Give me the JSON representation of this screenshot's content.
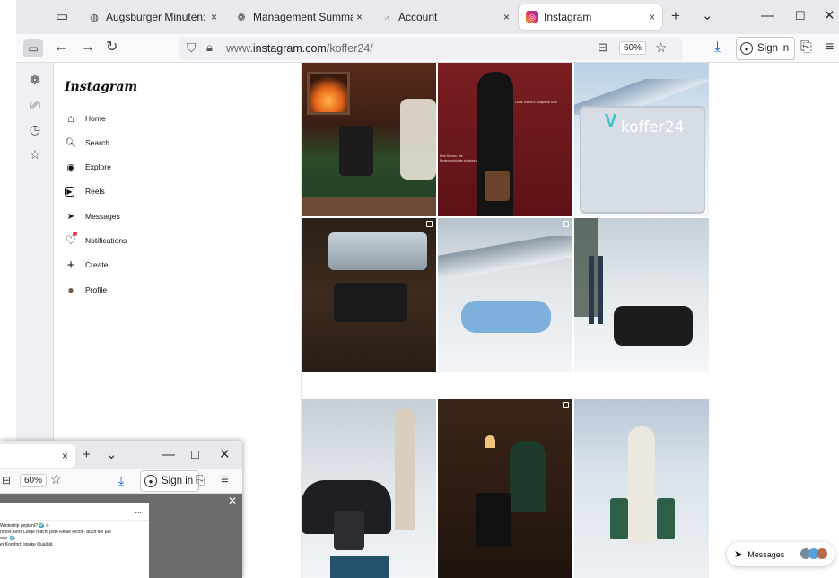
{
  "browser": {
    "tabs": [
      {
        "label": "Augsburger Minuten: Fight",
        "icon": "augsburger-icon"
      },
      {
        "label": "Management Summary No",
        "icon": "chatgpt-icon"
      },
      {
        "label": "Account",
        "icon": "account-icon"
      },
      {
        "label": "Instagram",
        "icon": "instagram-icon",
        "active": true
      }
    ],
    "url_prefix": "www.",
    "url_domain": "instagram.com",
    "url_path": "/koffer24/",
    "zoom": "60%",
    "sign_in": "Sign in",
    "new_tab_glyph": "+",
    "tab_list_glyph": "⌄",
    "close_glyph": "×"
  },
  "instagram": {
    "logo": "Instagram",
    "nav": [
      {
        "label": "Home",
        "icon": "home-icon",
        "glyph": "⌂"
      },
      {
        "label": "Search",
        "icon": "search-icon",
        "glyph": "🔍︎"
      },
      {
        "label": "Explore",
        "icon": "explore-icon",
        "glyph": "◉"
      },
      {
        "label": "Reels",
        "icon": "reels-icon",
        "glyph": "▶"
      },
      {
        "label": "Messages",
        "icon": "messages-icon",
        "glyph": "➤"
      },
      {
        "label": "Notifications",
        "icon": "heart-icon",
        "glyph": "♡"
      },
      {
        "label": "Create",
        "icon": "plus-icon",
        "glyph": "+"
      },
      {
        "label": "Profile",
        "icon": "avatar",
        "glyph": "●"
      }
    ],
    "messages_label": "Messages",
    "post_text_2_line1": "Louis Vuitton's Sculptural Icon",
    "post_text_2_line2": "Eine Kurven, die Modegeschichte schreiben.",
    "post_text_3": "koffer24"
  },
  "second_window": {
    "zoom": "60%",
    "sign_in": "Sign in",
    "caption_lines": [
      "Wintertrip geplant? 🌍 ✈",
      "rimox Airox Large macht jede Reise leicht - auch bei Eis",
      "see. 🌍",
      "er Komfort, starke Qualität."
    ],
    "more": "..."
  },
  "colors": {
    "tab_strip": "#e8e9ec",
    "accent_blue": "#0061e0",
    "instagram_gradient": "#e1306c"
  }
}
